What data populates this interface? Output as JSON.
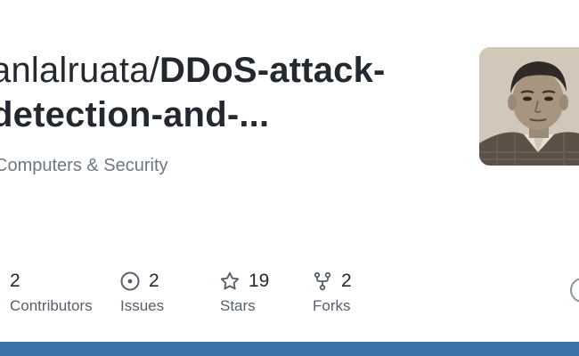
{
  "repo": {
    "owner": "anlalruata",
    "separator": "/",
    "name_line1": "DDoS-attack-",
    "name_line2": "detection-and-...",
    "description": "Computers & Security"
  },
  "stats": [
    {
      "count": "2",
      "label": "Contributors",
      "icon": "people-icon"
    },
    {
      "count": "2",
      "label": "Issues",
      "icon": "issue-opened-icon"
    },
    {
      "count": "19",
      "label": "Stars",
      "icon": "star-icon"
    },
    {
      "count": "2",
      "label": "Forks",
      "icon": "repo-forked-icon"
    }
  ],
  "colors": {
    "title": "#24292f",
    "muted": "#6e7781",
    "icon": "#57606a",
    "bottom_bar": "#3d72a8"
  },
  "avatar_icon": "avatar-photo",
  "logo_icon": "github-mark-icon"
}
